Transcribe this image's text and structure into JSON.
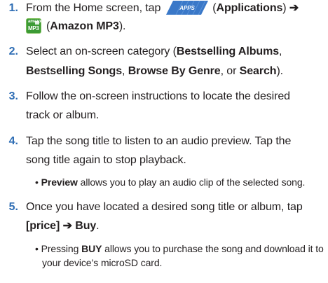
{
  "steps": [
    {
      "number": "1.",
      "line1_pre": "From the Home screen, tap",
      "apps_label": "APPS",
      "line1_paren_open": "(",
      "line1_bold1": "Applications",
      "line1_paren_close": ")",
      "arrow": "➔",
      "amazon_icon_top": "amazon",
      "amazon_icon_bottom": "MP3",
      "line2_paren_open": "(",
      "line2_bold": "Amazon MP3",
      "line2_paren_close": ")."
    },
    {
      "number": "2.",
      "line1_pre": "Select an on-screen category (",
      "bold1": "Bestselling Albums",
      "comma1": ",",
      "bold2": "Bestselling Songs",
      "comma2": ", ",
      "bold3": "Browse By Genre",
      "or": ", or ",
      "bold4": "Search",
      "end": ")."
    },
    {
      "number": "3.",
      "line1": "Follow the on-screen instructions to locate the desired",
      "line2": "track or album."
    },
    {
      "number": "4.",
      "line1": "Tap the song title to listen to an audio preview. Tap the",
      "line2": "song title again to stop playback.",
      "bullet": "•",
      "bullet_bold": "Preview",
      "bullet_text": " allows you to play an audio clip of the selected song."
    },
    {
      "number": "5.",
      "line1": "Once you have located a desired song title or album, tap",
      "line2_bold1": "[price]",
      "arrow": "➔",
      "line2_bold2": "Buy",
      "line2_end": ".",
      "bullet": "•",
      "bullet_pre": "Pressing ",
      "bullet_bold": "BUY",
      "bullet_text1": " allows you to purchase the song and download it to",
      "bullet_text2": "your device’s microSD card."
    }
  ],
  "colors": {
    "number": "#2e6db4",
    "text": "#231f20",
    "apps_button": "#3a78c8",
    "amazon_icon": "#3c9a35"
  },
  "icons": {
    "apps": "apps-button-icon",
    "amazon": "amazon-mp3-app-icon"
  }
}
